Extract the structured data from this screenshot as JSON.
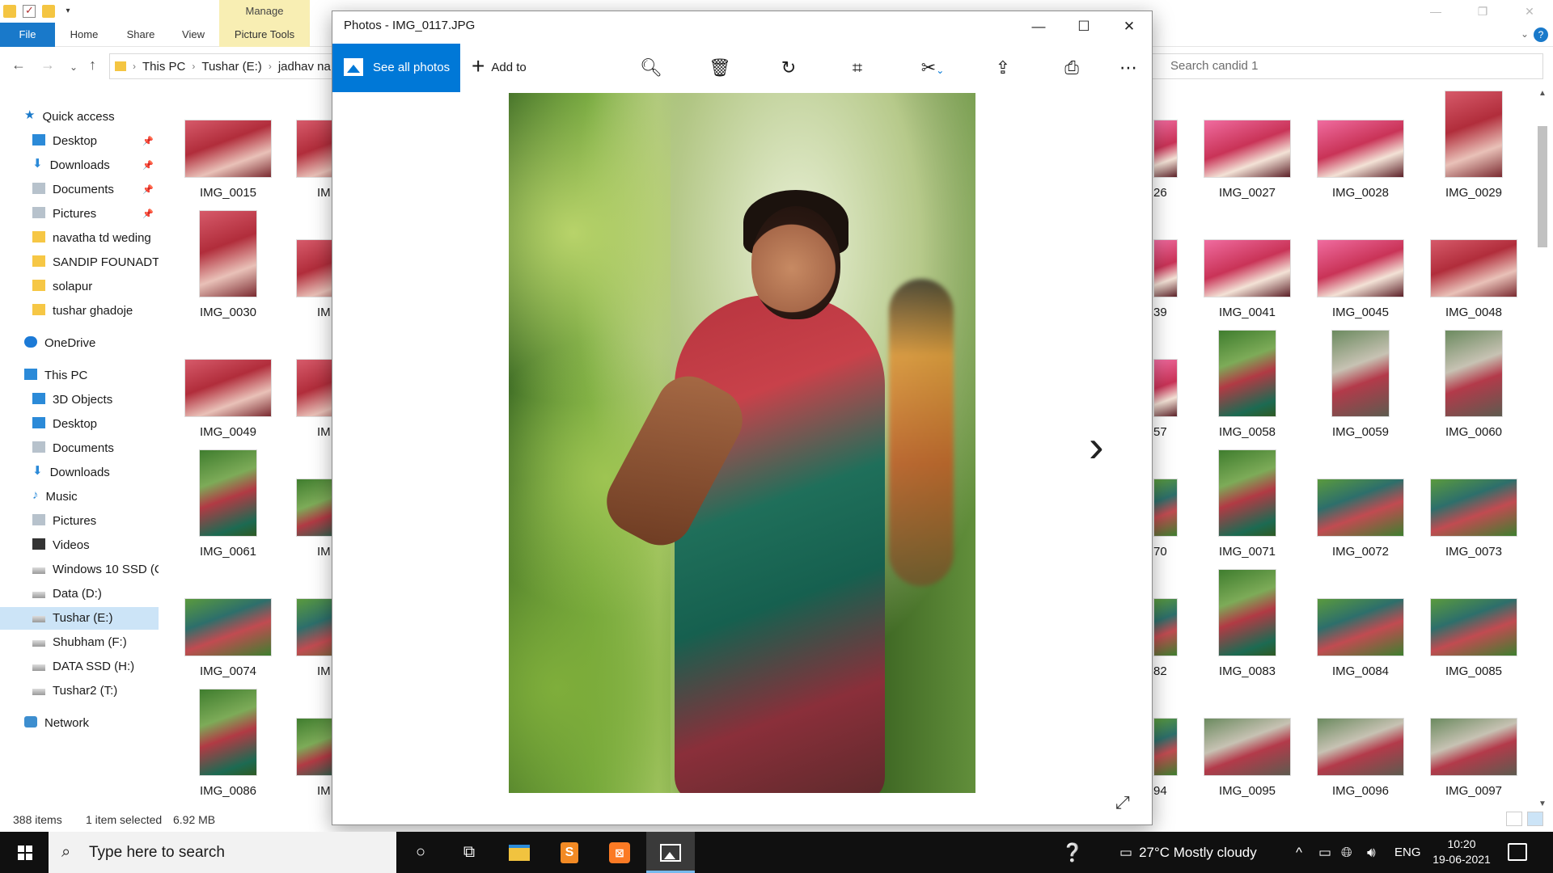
{
  "explorer": {
    "ribbon": {
      "manage_label": "Manage",
      "tabs": [
        "File",
        "Home",
        "Share",
        "View",
        "Picture Tools"
      ],
      "help": "?"
    },
    "address": {
      "path": [
        "This PC",
        "Tushar (E:)",
        "jadhav na"
      ],
      "search_placeholder": "Search candid 1"
    },
    "nav": {
      "quick_access": "Quick access",
      "quick_items": [
        {
          "label": "Desktop",
          "icon": "desktop-icon",
          "pinned": true
        },
        {
          "label": "Downloads",
          "icon": "downloads-icon",
          "pinned": true
        },
        {
          "label": "Documents",
          "icon": "documents-icon",
          "pinned": true
        },
        {
          "label": "Pictures",
          "icon": "pictures-icon",
          "pinned": true
        },
        {
          "label": "navatha td weding",
          "icon": "folder-icon",
          "pinned": false
        },
        {
          "label": "SANDIP FOUNADTI(",
          "icon": "folder-icon",
          "pinned": false
        },
        {
          "label": "solapur",
          "icon": "folder-icon",
          "pinned": false
        },
        {
          "label": "tushar ghadoje",
          "icon": "folder-icon",
          "pinned": false
        }
      ],
      "onedrive": "OneDrive",
      "this_pc": "This PC",
      "pc_items": [
        {
          "label": "3D Objects",
          "icon": "3d-objects-icon"
        },
        {
          "label": "Desktop",
          "icon": "desktop-icon"
        },
        {
          "label": "Documents",
          "icon": "documents-icon"
        },
        {
          "label": "Downloads",
          "icon": "downloads-icon"
        },
        {
          "label": "Music",
          "icon": "music-icon"
        },
        {
          "label": "Pictures",
          "icon": "pictures-icon"
        },
        {
          "label": "Videos",
          "icon": "videos-icon"
        },
        {
          "label": "Windows 10 SSD (C",
          "icon": "drive-icon"
        },
        {
          "label": "Data (D:)",
          "icon": "drive-icon"
        },
        {
          "label": "Tushar (E:)",
          "icon": "drive-icon",
          "selected": true
        },
        {
          "label": "Shubham (F:)",
          "icon": "drive-icon"
        },
        {
          "label": "DATA SSD (H:)",
          "icon": "drive-icon"
        },
        {
          "label": "Tushar2 (T:)",
          "icon": "drive-icon"
        }
      ],
      "network": "Network"
    },
    "thumbs_left": [
      {
        "label": "IMG_0015",
        "shape": "land",
        "tone": "red"
      },
      {
        "label": "IMG_0030",
        "shape": "port",
        "tone": "red"
      },
      {
        "label": "IMG_0049",
        "shape": "land",
        "tone": "red"
      },
      {
        "label": "IMG_0061",
        "shape": "port",
        "tone": "green"
      },
      {
        "label": "IMG_0074",
        "shape": "land",
        "tone": "greenwide"
      },
      {
        "label": "IMG_0086",
        "shape": "port",
        "tone": "green"
      }
    ],
    "thumbs_col2_labels": [
      "IM",
      "IM",
      "IM",
      "IM",
      "IM",
      "IM"
    ],
    "thumbs_partial_labels": [
      "26",
      "39",
      "57",
      "70",
      "82",
      "94"
    ],
    "thumbs_right": [
      [
        {
          "label": "IMG_0027",
          "shape": "land",
          "tone": "pink"
        },
        {
          "label": "IMG_0028",
          "shape": "land",
          "tone": "pink"
        },
        {
          "label": "IMG_0029",
          "shape": "port",
          "tone": "red"
        }
      ],
      [
        {
          "label": "IMG_0041",
          "shape": "land",
          "tone": "pink"
        },
        {
          "label": "IMG_0045",
          "shape": "land",
          "tone": "pink"
        },
        {
          "label": "IMG_0048",
          "shape": "land",
          "tone": "red"
        }
      ],
      [
        {
          "label": "IMG_0058",
          "shape": "port",
          "tone": "green"
        },
        {
          "label": "IMG_0059",
          "shape": "port",
          "tone": "road"
        },
        {
          "label": "IMG_0060",
          "shape": "port",
          "tone": "road"
        }
      ],
      [
        {
          "label": "IMG_0071",
          "shape": "port",
          "tone": "green"
        },
        {
          "label": "IMG_0072",
          "shape": "land",
          "tone": "greenwide"
        },
        {
          "label": "IMG_0073",
          "shape": "land",
          "tone": "greenwide"
        }
      ],
      [
        {
          "label": "IMG_0083",
          "shape": "port",
          "tone": "green"
        },
        {
          "label": "IMG_0084",
          "shape": "land",
          "tone": "greenwide"
        },
        {
          "label": "IMG_0085",
          "shape": "land",
          "tone": "greenwide"
        }
      ],
      [
        {
          "label": "IMG_0095",
          "shape": "land",
          "tone": "road"
        },
        {
          "label": "IMG_0096",
          "shape": "land",
          "tone": "road"
        },
        {
          "label": "IMG_0097",
          "shape": "land",
          "tone": "road"
        }
      ]
    ],
    "status": {
      "count": "388 items",
      "selection": "1 item selected",
      "size": "6.92 MB"
    }
  },
  "photos": {
    "title": "Photos - IMG_0117.JPG",
    "see_all": "See all photos",
    "add_to": "Add to",
    "toolbar_icons": [
      "zoom-icon",
      "delete-icon",
      "rotate-icon",
      "crop-icon",
      "edit-icon",
      "share-icon",
      "print-icon",
      "more-icon"
    ]
  },
  "taskbar": {
    "search_placeholder": "Type here to search",
    "weather": "27°C  Mostly cloudy",
    "language": "ENG",
    "time": "10:20",
    "date": "19-06-2021"
  },
  "colors": {
    "accent": "#0078d7",
    "file_tab": "#1979ca",
    "manage_tab": "#f8eeb3",
    "selection": "#cce4f7"
  }
}
